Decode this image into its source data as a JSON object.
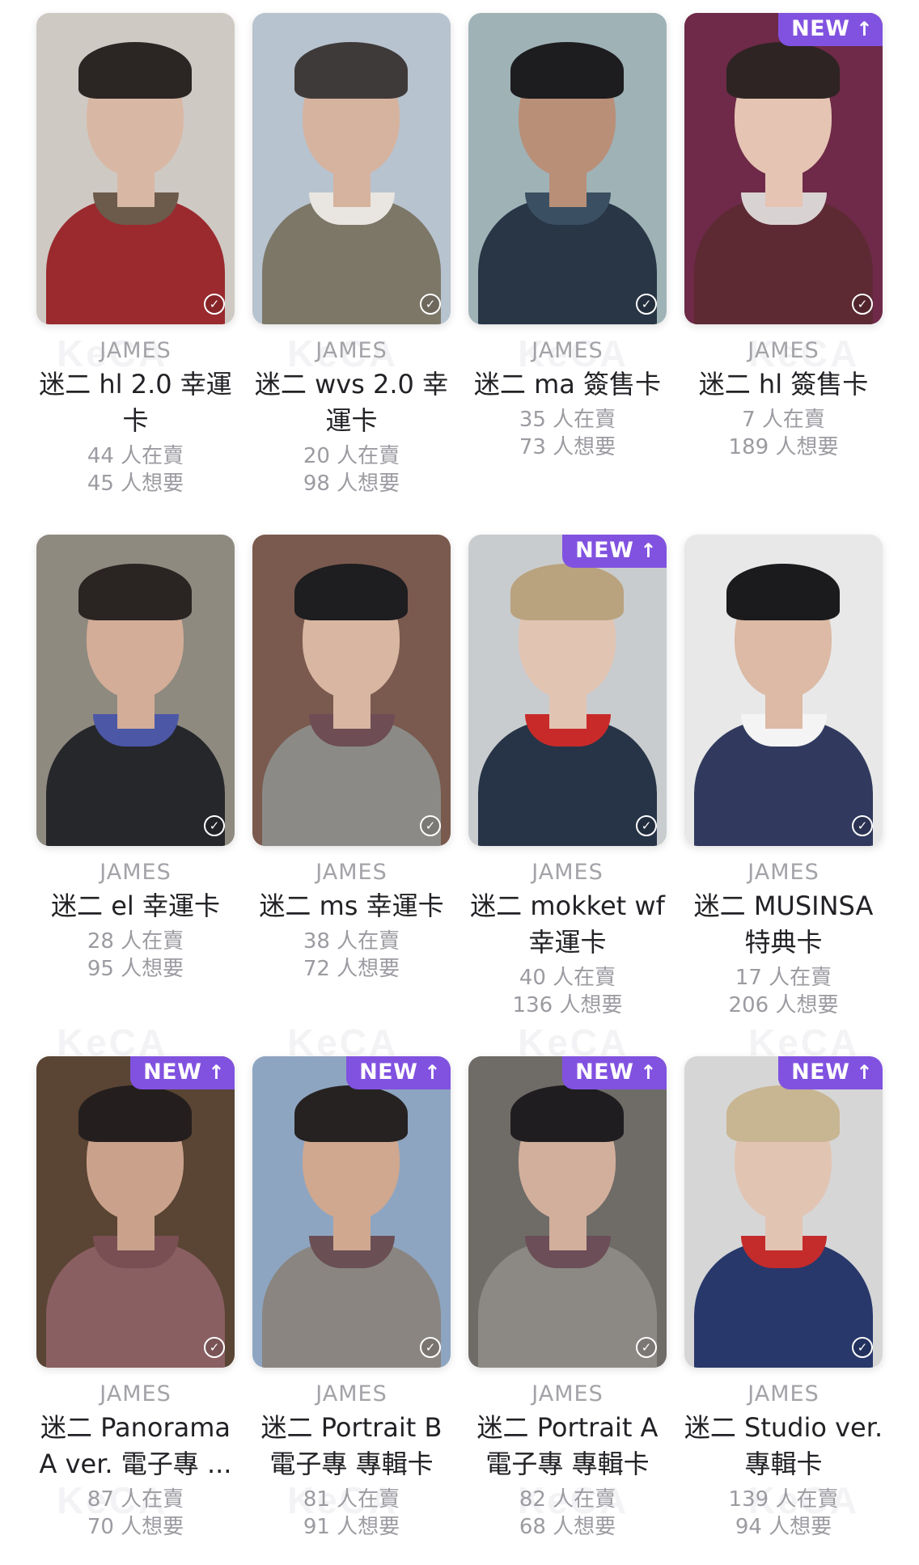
{
  "watermark_text": "KeCA",
  "new_badge_label": "NEW",
  "new_badge_arrow": "↑",
  "check_glyph": "✓",
  "cards": [
    {
      "artist": "JAMES",
      "title": "迷二 hl 2.0 幸運卡",
      "selling": "44 人在賣",
      "wanting": "45 人想要",
      "is_new": false,
      "title_lines": 2,
      "colors": {
        "bg": "#cfc9c4",
        "skin": "#d8b8a4",
        "hair": "#2b2524",
        "cloth": "#9a2a2e",
        "collar": "#6c5a4a"
      }
    },
    {
      "artist": "JAMES",
      "title": "迷二 wvs 2.0 幸運卡",
      "selling": "20 人在賣",
      "wanting": "98 人想要",
      "is_new": false,
      "title_lines": 2,
      "colors": {
        "bg": "#b7c3cf",
        "skin": "#d6b39f",
        "hair": "#3f3a3a",
        "cloth": "#7d7768",
        "collar": "#e9e6e1"
      }
    },
    {
      "artist": "JAMES",
      "title": "迷二 ma 簽售卡",
      "selling": "35 人在賣",
      "wanting": "73 人想要",
      "is_new": false,
      "title_lines": 1,
      "colors": {
        "bg": "#9fb2b6",
        "skin": "#b98f78",
        "hair": "#1d1c1f",
        "cloth": "#283646",
        "collar": "#3b4f62"
      }
    },
    {
      "artist": "JAMES",
      "title": "迷二 hl 簽售卡",
      "selling": "7 人在賣",
      "wanting": "189 人想要",
      "is_new": true,
      "title_lines": 1,
      "colors": {
        "bg": "#6e2a48",
        "skin": "#e5c4b3",
        "hair": "#2e2423",
        "cloth": "#5d2a33",
        "collar": "#d9d2d2"
      }
    },
    {
      "artist": "JAMES",
      "title": "迷二 el 幸運卡",
      "selling": "28 人在賣",
      "wanting": "95 人想要",
      "is_new": false,
      "title_lines": 1,
      "colors": {
        "bg": "#8f8a80",
        "skin": "#d3ad98",
        "hair": "#2a2422",
        "cloth": "#26272b",
        "collar": "#4c57a6"
      }
    },
    {
      "artist": "JAMES",
      "title": "迷二 ms 幸運卡",
      "selling": "38 人在賣",
      "wanting": "72 人想要",
      "is_new": false,
      "title_lines": 1,
      "colors": {
        "bg": "#7a5a4e",
        "skin": "#d8b6a2",
        "hair": "#1e1d20",
        "cloth": "#8b8a86",
        "collar": "#6e4d55"
      }
    },
    {
      "artist": "JAMES",
      "title": "迷二 mokket wf 幸運卡",
      "selling": "40 人在賣",
      "wanting": "136 人想要",
      "is_new": true,
      "title_lines": 2,
      "colors": {
        "bg": "#c9ccce",
        "skin": "#e2c4b3",
        "hair": "#b9a27e",
        "cloth": "#273447",
        "collar": "#c82a2a"
      }
    },
    {
      "artist": "JAMES",
      "title": "迷二 MUSINSA 特典卡",
      "selling": "17 人在賣",
      "wanting": "206 人想要",
      "is_new": false,
      "title_lines": 2,
      "colors": {
        "bg": "#e8e8e8",
        "skin": "#dcbaa6",
        "hair": "#1b1a1c",
        "cloth": "#313a5e",
        "collar": "#f4f4f4"
      }
    },
    {
      "artist": "JAMES",
      "title": "迷二 Panorama A ver. 電子專 ...",
      "selling": "87 人在賣",
      "wanting": "70 人想要",
      "is_new": true,
      "title_lines": 2,
      "colors": {
        "bg": "#5a4434",
        "skin": "#caa28b",
        "hair": "#241f1e",
        "cloth": "#8a5f62",
        "collar": "#7a4f53"
      }
    },
    {
      "artist": "JAMES",
      "title": "迷二 Portrait B 電子專 專輯卡",
      "selling": "81 人在賣",
      "wanting": "91 人想要",
      "is_new": true,
      "title_lines": 2,
      "colors": {
        "bg": "#8ea5c1",
        "skin": "#d0a88f",
        "hair": "#262222",
        "cloth": "#8a8580",
        "collar": "#6a4f55"
      }
    },
    {
      "artist": "JAMES",
      "title": "迷二 Portrait A 電子專 專輯卡",
      "selling": "82 人在賣",
      "wanting": "68 人想要",
      "is_new": true,
      "title_lines": 2,
      "colors": {
        "bg": "#6f6c68",
        "skin": "#d2af9c",
        "hair": "#1f1d1f",
        "cloth": "#8c8884",
        "collar": "#6b4e58"
      }
    },
    {
      "artist": "JAMES",
      "title": "迷二 Studio ver. 專輯卡",
      "selling": "139 人在賣",
      "wanting": "94 人想要",
      "is_new": true,
      "title_lines": 2,
      "colors": {
        "bg": "#d6d6d6",
        "skin": "#e2c4b3",
        "hair": "#c8b592",
        "cloth": "#28386b",
        "collar": "#c42b2b"
      }
    }
  ]
}
